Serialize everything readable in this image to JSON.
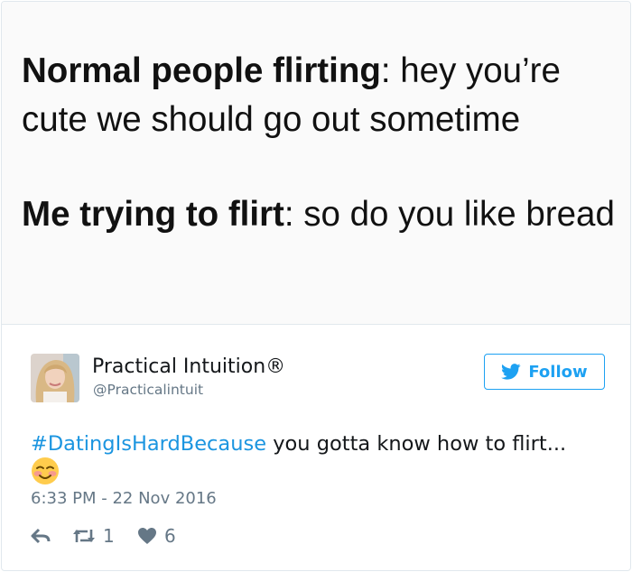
{
  "meme": {
    "line1_bold": "Normal people flirting",
    "line1_rest": ": hey you’re cute we should go out sometime",
    "line2_bold": "Me trying to flirt",
    "line2_rest": ": so do you like bread"
  },
  "author": {
    "name": "Practical Intuition®",
    "handle": "@Practicalintuit",
    "avatar_icon": "profile-photo"
  },
  "follow_button": {
    "label": "Follow",
    "icon": "twitter-bird-icon",
    "color": "#1da1f2"
  },
  "tweet": {
    "hashtag": "#DatingIsHardBecause",
    "text": " you gotta know how to flirt...",
    "emoji_icon": "smiling-face-icon",
    "timestamp": "6:33 PM - 22 Nov 2016",
    "hashtag_color": "#1b95e0"
  },
  "actions": {
    "reply_icon": "reply-icon",
    "retweet_icon": "retweet-icon",
    "retweet_count": "1",
    "like_icon": "heart-icon",
    "like_count": "6"
  }
}
